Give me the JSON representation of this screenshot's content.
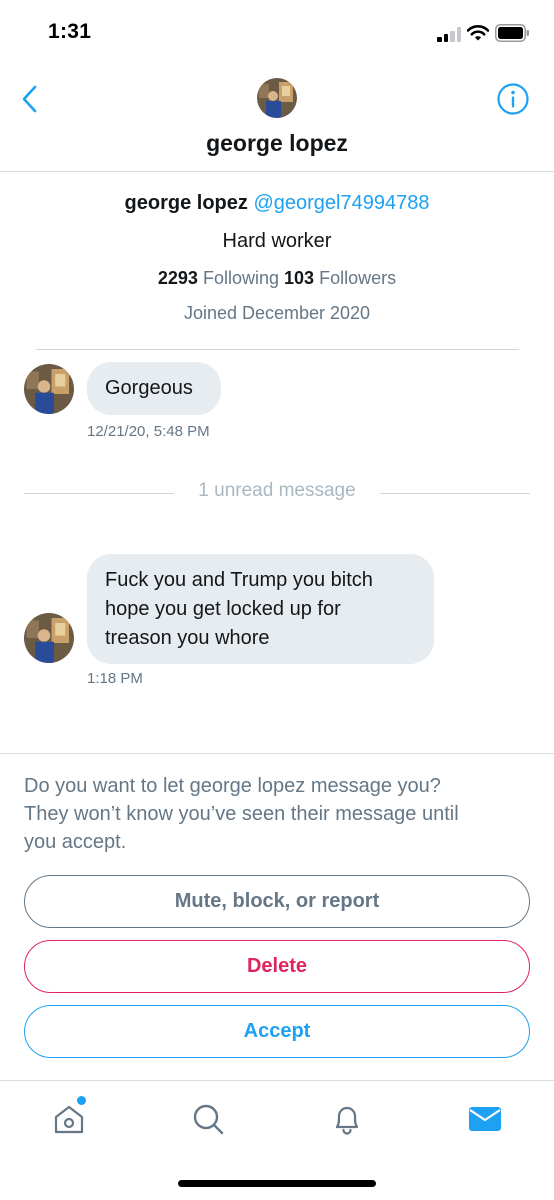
{
  "status_bar": {
    "time": "1:31",
    "signal_icon": "cellular-signal-icon",
    "wifi_icon": "wifi-icon",
    "battery_icon": "battery-icon"
  },
  "header": {
    "back_icon": "chevron-left-icon",
    "info_icon": "info-icon",
    "title": "george lopez"
  },
  "profile": {
    "name": "george lopez",
    "handle": "@georgel74994788",
    "bio": "Hard worker",
    "following_count": "2293",
    "following_label": "Following",
    "followers_count": "103",
    "followers_label": "Followers",
    "joined": "Joined December 2020"
  },
  "messages": [
    {
      "text": "Gorgeous",
      "timestamp": "12/21/20, 5:48 PM"
    },
    {
      "text": "Fuck you and Trump you bitch hope you get locked up for treason you whore",
      "timestamp": "1:18 PM"
    }
  ],
  "message_lines": [
    "Fuck you and Trump you bitch",
    "hope you get locked up for",
    "treason you whore"
  ],
  "unread_divider": "1 unread message",
  "request": {
    "prompt": "Do you want to let george lopez message you? They won’t know you’ve seen their message until you accept.",
    "prompt_lines": [
      "Do you want to let george lopez message you?",
      "They won’t know you’ve seen their message until",
      "you accept."
    ],
    "mute_label": "Mute, block, or report",
    "delete_label": "Delete",
    "accept_label": "Accept"
  },
  "tab_bar": {
    "tabs": [
      {
        "icon": "home-icon",
        "has_notification_dot": true
      },
      {
        "icon": "search-icon"
      },
      {
        "icon": "bell-icon"
      },
      {
        "icon": "mail-icon",
        "active": true
      }
    ]
  },
  "colors": {
    "accent": "#1da1f2",
    "danger": "#e0245e",
    "muted": "#657786",
    "bubble": "#e6ecf0"
  }
}
